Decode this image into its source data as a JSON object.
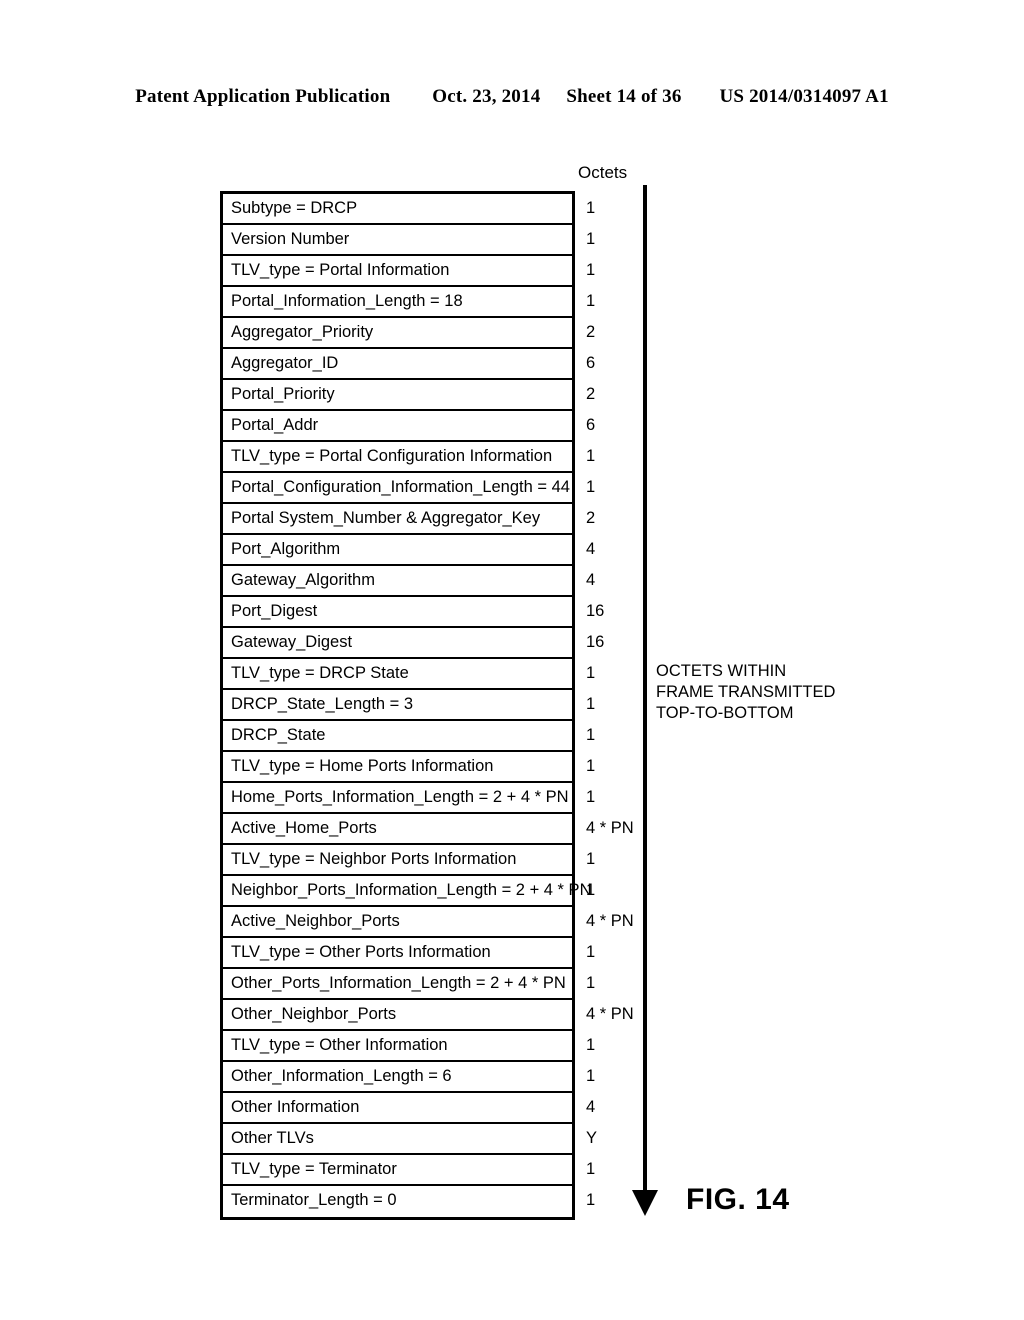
{
  "page_header": {
    "publication": "Patent Application Publication",
    "date": "Oct. 23, 2014",
    "sheet": "Sheet 14 of 36",
    "doc_number": "US 2014/0314097 A1"
  },
  "figure": {
    "caption": "FIG. 14",
    "octets_column_heading": "Octets",
    "arrow": {
      "name": "transmission-order-arrow",
      "direction": "down",
      "note_line_1": "OCTETS WITHIN",
      "note_line_2": "FRAME TRANSMITTED",
      "note_line_3": "TOP-TO-BOTTOM"
    },
    "rows": [
      {
        "label": "Subtype = DRCP",
        "octets": "1"
      },
      {
        "label": "Version Number",
        "octets": "1"
      },
      {
        "label": "TLV_type = Portal Information",
        "octets": "1"
      },
      {
        "label": "Portal_Information_Length = 18",
        "octets": "1"
      },
      {
        "label": "Aggregator_Priority",
        "octets": "2"
      },
      {
        "label": "Aggregator_ID",
        "octets": "6"
      },
      {
        "label": "Portal_Priority",
        "octets": "2"
      },
      {
        "label": "Portal_Addr",
        "octets": "6"
      },
      {
        "label": "TLV_type = Portal Configuration Information",
        "octets": "1"
      },
      {
        "label": "Portal_Configuration_Information_Length = 44",
        "octets": "1"
      },
      {
        "label": "Portal System_Number & Aggregator_Key",
        "octets": "2"
      },
      {
        "label": "Port_Algorithm",
        "octets": "4"
      },
      {
        "label": "Gateway_Algorithm",
        "octets": "4"
      },
      {
        "label": "Port_Digest",
        "octets": "16"
      },
      {
        "label": "Gateway_Digest",
        "octets": "16"
      },
      {
        "label": "TLV_type = DRCP State",
        "octets": "1"
      },
      {
        "label": "DRCP_State_Length = 3",
        "octets": "1"
      },
      {
        "label": "DRCP_State",
        "octets": "1"
      },
      {
        "label": "TLV_type = Home Ports Information",
        "octets": "1"
      },
      {
        "label": "Home_Ports_Information_Length = 2 + 4 * PN",
        "octets": "1"
      },
      {
        "label": "Active_Home_Ports",
        "octets": "4 * PN"
      },
      {
        "label": "TLV_type = Neighbor Ports Information",
        "octets": "1"
      },
      {
        "label": "Neighbor_Ports_Information_Length = 2 + 4 * PN",
        "octets": "1"
      },
      {
        "label": "Active_Neighbor_Ports",
        "octets": "4 * PN"
      },
      {
        "label": "TLV_type = Other Ports Information",
        "octets": "1"
      },
      {
        "label": "Other_Ports_Information_Length = 2 + 4 * PN",
        "octets": "1"
      },
      {
        "label": "Other_Neighbor_Ports",
        "octets": "4 * PN"
      },
      {
        "label": "TLV_type = Other Information",
        "octets": "1"
      },
      {
        "label": "Other_Information_Length = 6",
        "octets": "1"
      },
      {
        "label": "Other Information",
        "octets": "4"
      },
      {
        "label": "Other TLVs",
        "octets": "Y"
      },
      {
        "label": "TLV_type = Terminator",
        "octets": "1"
      },
      {
        "label": "Terminator_Length = 0",
        "octets": "1"
      }
    ]
  }
}
